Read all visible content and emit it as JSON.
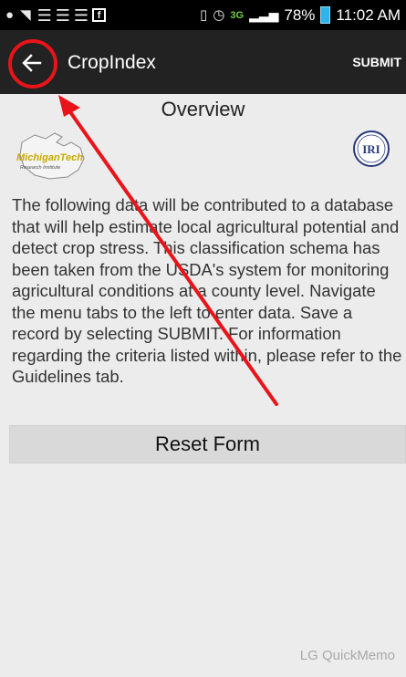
{
  "status_bar": {
    "network_type": "3G",
    "battery_percent": "78%",
    "time": "11:02 AM",
    "icons": [
      "notification-icon",
      "mute-icon",
      "menu-icon",
      "menu-icon",
      "menu-icon",
      "facebook-icon",
      "vibrate-icon",
      "alarm-icon",
      "signal-icon",
      "battery-icon"
    ]
  },
  "app_bar": {
    "back_icon": "arrow-left-icon",
    "title": "CropIndex",
    "submit_label": "SUBMIT"
  },
  "content": {
    "title": "Overview",
    "logos": [
      "michigan-tech-research-institute-logo",
      "iri-logo"
    ],
    "logo_left_text": "MichiganTech",
    "logo_left_subtext": "Research Institute",
    "logo_right_text": "IRI",
    "description": "The following data will be contributed to a database that will help estimate local agricultural potential and detect crop stress. This classification schema has been taken from the USDA's system for monitoring agricultural conditions at a county level. Navigate the menu tabs to the left to enter data. Save a record by selecting SUBMIT. For information regarding the criteria listed within, please refer to the Guidelines tab.",
    "reset_label": "Reset Form"
  },
  "watermark": "LG QuickMemo",
  "colors": {
    "app_bar": "#222222",
    "annotation": "#e8141a",
    "battery": "#2fb3e8",
    "page_bg": "#ececec"
  }
}
